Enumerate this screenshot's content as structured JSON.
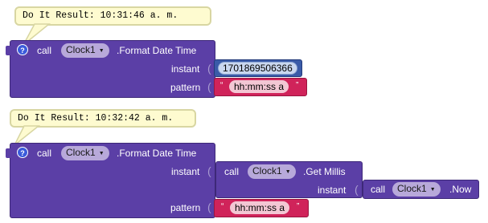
{
  "block1": {
    "result_text": "Do It Result: 10:31:46 a. m.",
    "call_label": "call",
    "component": "Clock1",
    "method": ".Format Date Time",
    "instant_label": "instant",
    "instant_value": "1701869506366",
    "pattern_label": "pattern",
    "pattern_value": "hh:mm:ss a",
    "quote_open": "“",
    "quote_close": "”"
  },
  "block2": {
    "result_text": "Do It Result: 10:32:42 a. m.",
    "call_label": "call",
    "component": "Clock1",
    "method": ".Format Date Time",
    "instant_label": "instant",
    "getmillis_call": "call",
    "getmillis_component": "Clock1",
    "getmillis_method": ".Get Millis",
    "now_instant_label": "instant",
    "now_call": "call",
    "now_component": "Clock1",
    "now_method": ".Now",
    "pattern_label": "pattern",
    "pattern_value": "hh:mm:ss a",
    "quote_open": "“",
    "quote_close": "”"
  },
  "icons": {
    "help": "?",
    "dropdown_arrow": "▼"
  },
  "colors": {
    "component_block": "#5b3fa6",
    "math_block": "#3a5ba8",
    "text_block": "#d0235a",
    "bubble_bg": "#fefbd0"
  }
}
